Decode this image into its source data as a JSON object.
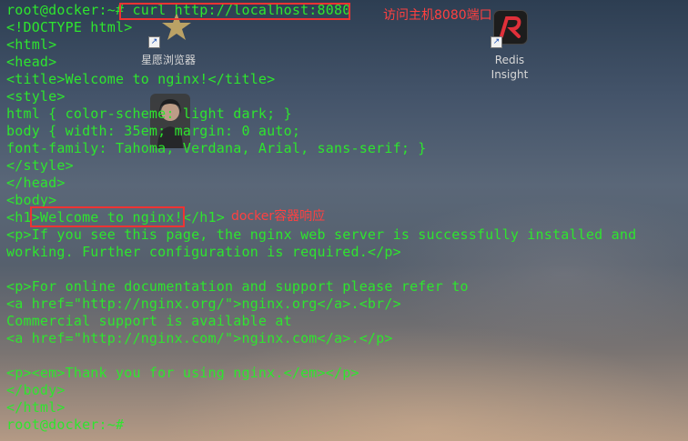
{
  "desktop": {
    "icons": [
      {
        "label": "星愿浏览器",
        "name": "star-browser-icon"
      },
      {
        "label": "Redis",
        "sublabel": "Insight",
        "name": "redis-insight-icon"
      }
    ]
  },
  "terminal": {
    "lines": [
      "root@docker:~# curl http://localhost:8080",
      "<!DOCTYPE html>",
      "<html>",
      "<head>",
      "<title>Welcome to nginx!</title>",
      "<style>",
      "html { color-scheme: light dark; }",
      "body { width: 35em; margin: 0 auto;",
      "font-family: Tahoma, Verdana, Arial, sans-serif; }",
      "</style>",
      "</head>",
      "<body>",
      "<h1>Welcome to nginx!</h1>",
      "<p>If you see this page, the nginx web server is successfully installed and",
      "working. Further configuration is required.</p>",
      "",
      "<p>For online documentation and support please refer to",
      "<a href=\"http://nginx.org/\">nginx.org</a>.<br/>",
      "Commercial support is available at",
      "<a href=\"http://nginx.com/\">nginx.com</a>.</p>",
      "",
      "<p><em>Thank you for using nginx.</em></p>",
      "</body>",
      "</html>",
      "root@docker:~#"
    ]
  },
  "annotations": {
    "access_note": "访问主机8080端口",
    "response_note": "docker容器响应"
  },
  "colors": {
    "terminal_text": "#2ee52e",
    "annotation": "#ff4040"
  }
}
